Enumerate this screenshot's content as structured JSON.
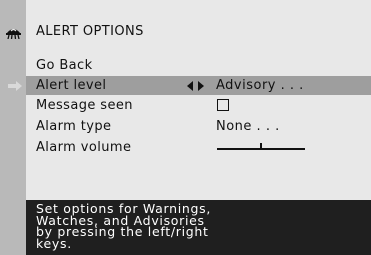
{
  "header": {
    "title": "ALERT OPTIONS",
    "icon": "siren-icon"
  },
  "menu": {
    "items": [
      {
        "label": "Go Back"
      },
      {
        "label": "Alert level",
        "value": "Advisory . . .",
        "selected": true
      },
      {
        "label": "Message seen",
        "checked": false
      },
      {
        "label": "Alarm type",
        "value": "None . . ."
      },
      {
        "label": "Alarm volume",
        "level": 0.5
      }
    ],
    "selection_icon": "right-arrow-icon",
    "adjust_icon": "left-right-arrows-icon"
  },
  "help": {
    "text": "Set options for Warnings,\nWatches, and Advisories\nby pressing the left/right\nkeys."
  },
  "colors": {
    "rail": "#b9b9b9",
    "panel": "#e8e8e8",
    "selected_row": "#9e9e9e",
    "help_bg": "#1f1f1f"
  }
}
